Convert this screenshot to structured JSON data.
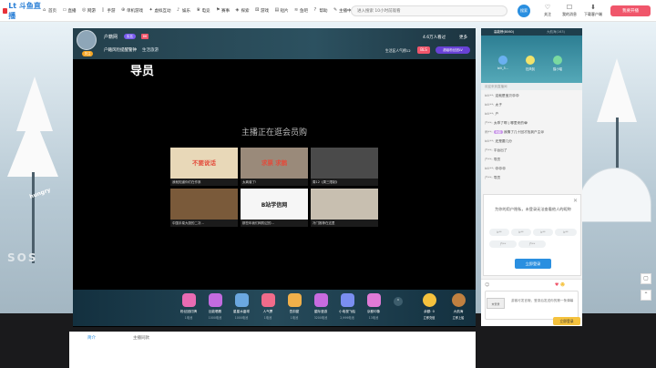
{
  "header": {
    "logo_text": "Lt 斗鱼直播",
    "nav": [
      {
        "label": "首页",
        "icon": "home-icon"
      },
      {
        "label": "直播",
        "icon": "tv-icon"
      },
      {
        "label": "网游",
        "icon": "gamepad-icon"
      },
      {
        "label": "手游",
        "icon": "phone-icon"
      },
      {
        "label": "单机游戏",
        "icon": "controller-icon"
      },
      {
        "label": "虚拟互动",
        "icon": "sparkle-icon"
      },
      {
        "label": "娱乐",
        "icon": "music-icon"
      },
      {
        "label": "电竞",
        "icon": "trophy-icon"
      },
      {
        "label": "赛事",
        "icon": "flag-icon"
      },
      {
        "label": "探索",
        "icon": "compass-icon"
      },
      {
        "label": "游戏",
        "icon": "dice-icon"
      },
      {
        "label": "短片",
        "icon": "film-icon"
      },
      {
        "label": "鱼吧",
        "icon": "fish-icon"
      },
      {
        "label": "帮助",
        "icon": "help-icon"
      },
      {
        "label": "主播中心",
        "icon": "mic-icon"
      },
      {
        "label": "购物",
        "icon": "cart-icon"
      }
    ],
    "search": {
      "placeholder": "进入搜索 10小时前观看",
      "button": "搜索"
    },
    "right_icons": [
      {
        "label": "关注",
        "icon": "heart-icon"
      },
      {
        "label": "我的消息",
        "icon": "bell-icon"
      },
      {
        "label": "下载客户端",
        "icon": "download-icon"
      }
    ],
    "start_live": "我要开播"
  },
  "room": {
    "host_name": "户籍网",
    "host_badge": "实名",
    "host_level": "86",
    "title": "户籍风险提醒警钟",
    "category": "生活旅游",
    "follow": "关注",
    "online": "4.6万人看过",
    "more": "更多",
    "rank_label": "生活区人气榜12",
    "rank_pill": "BLS",
    "guard": "超级粉丝团LV"
  },
  "video": {
    "label": "导员",
    "heading": "主播正在逛会员购",
    "cards": [
      {
        "title": "我就知道你们在作祟",
        "thumb_text": "不要说话",
        "color": "#e8d8b8"
      },
      {
        "title": "太离谱了!",
        "thumb_text": "求票 求鹅",
        "color": "#9a8a7a"
      },
      {
        "title": "周12《周三限制》",
        "thumb_text": "",
        "color": "#4a4a4a"
      },
      {
        "title": "中国手菜大厨的二次...",
        "thumb_text": "",
        "color": "#7a5a3a"
      },
      {
        "title": "那些年我们网购过的...",
        "thumb_text": "B站学信网",
        "color": "#f6f6f6"
      },
      {
        "title": "冷门推荐在这里",
        "thumb_text": "",
        "color": "#c8bfb0"
      }
    ]
  },
  "gifts": [
    {
      "name": "粉丝团灯牌",
      "price": "1电池",
      "color": "#e96bb3"
    },
    {
      "name": "巨能唱歌",
      "price": "1000电池",
      "color": "#c36be0"
    },
    {
      "name": "星星水晶球",
      "price": "1000电池",
      "color": "#6ba8e0"
    },
    {
      "name": "人气票",
      "price": "1电池",
      "color": "#f06b8a"
    },
    {
      "name": "吾扣甜",
      "price": "1电池",
      "color": "#f0b04a"
    },
    {
      "name": "星际漫游",
      "price": "3200电池",
      "color": "#c86be0"
    },
    {
      "name": "小电视飞船",
      "price": "2,999电池",
      "color": "#7a8ef0"
    },
    {
      "name": "京都印象",
      "price": "13电池",
      "color": "#e07ad6"
    }
  ],
  "gift_side": [
    {
      "name": "余额: 0",
      "extra": "立即充值",
      "color": "#f5c23d"
    },
    {
      "name": "大航海",
      "extra": "立即上船",
      "color": "#c08040"
    }
  ],
  "chat": {
    "tabs": [
      "高能榜(8060)",
      "大航海(163)"
    ],
    "fans": [
      {
        "name": "bili_5...",
        "color": "#6ab0f0"
      },
      {
        "name": "狂风侃",
        "color": "#f2e36b"
      },
      {
        "name": "猫小喵",
        "color": "#7ad9a0"
      }
    ],
    "notice": "欢迎来到直播间",
    "lines": [
      {
        "user": "bili**:",
        "text": "这就是宝贝😍😍"
      },
      {
        "user": "bili**:",
        "text": "太子"
      },
      {
        "user": "bili**:",
        "text": "户"
      },
      {
        "user": "户**:",
        "text": "太乖了啊 | 哪里来的😂"
      },
      {
        "user": "雨**:",
        "tag": "收藏",
        "text": "我猜了几十回才找到户主😢"
      },
      {
        "user": "bili**:",
        "text": "还是要几分"
      },
      {
        "user": "户**:",
        "text": "平台出了"
      },
      {
        "user": "户**:",
        "text": "导员"
      },
      {
        "user": "bili**:",
        "text": "😍😍😍"
      },
      {
        "user": "户**:",
        "text": "导员"
      }
    ]
  },
  "login_popup": {
    "text": "为你的用户隐私，未登录无法查看他人的昵称",
    "chips": [
      "b**",
      "b**",
      "b**",
      "b**",
      "户**",
      "户**"
    ],
    "button": "立即登录"
  },
  "chat_input": {
    "placeholder": "游客可发言哦，登录后发送你的第一条弹幕",
    "avatar": "未登录",
    "login": "立即登录"
  },
  "below_tabs": [
    "简介",
    "主播同款"
  ]
}
